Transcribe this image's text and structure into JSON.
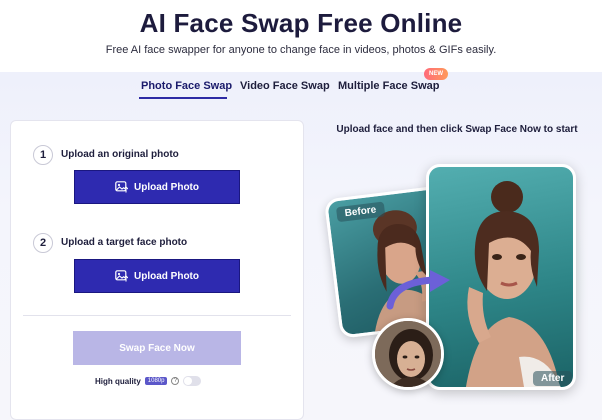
{
  "header": {
    "title": "AI Face Swap Free Online",
    "subtitle": "Free AI face swapper for anyone to change face in videos, photos & GIFs easily."
  },
  "tabs": [
    {
      "label": "Photo Face Swap",
      "active": true
    },
    {
      "label": "Video Face Swap",
      "active": false
    },
    {
      "label": "Multiple Face Swap",
      "active": false,
      "badge": "NEW"
    }
  ],
  "upload_panel": {
    "step1": {
      "number": "1",
      "label": "Upload an original photo",
      "button_label": "Upload Photo"
    },
    "step2": {
      "number": "2",
      "label": "Upload a target face photo",
      "button_label": "Upload Photo"
    },
    "swap_button_label": "Swap Face Now",
    "quality": {
      "label": "High quality",
      "badge": "1080p",
      "help_icon": "?",
      "toggle_on": false
    }
  },
  "preview": {
    "heading": "Upload face and then click Swap Face Now to start",
    "before_label": "Before",
    "after_label": "After"
  },
  "colors": {
    "primary_button": "#2e2ab0",
    "disabled_button": "#b9b6e6",
    "new_badge": "#ff7a6a",
    "photo_bg": "#2e8688"
  }
}
